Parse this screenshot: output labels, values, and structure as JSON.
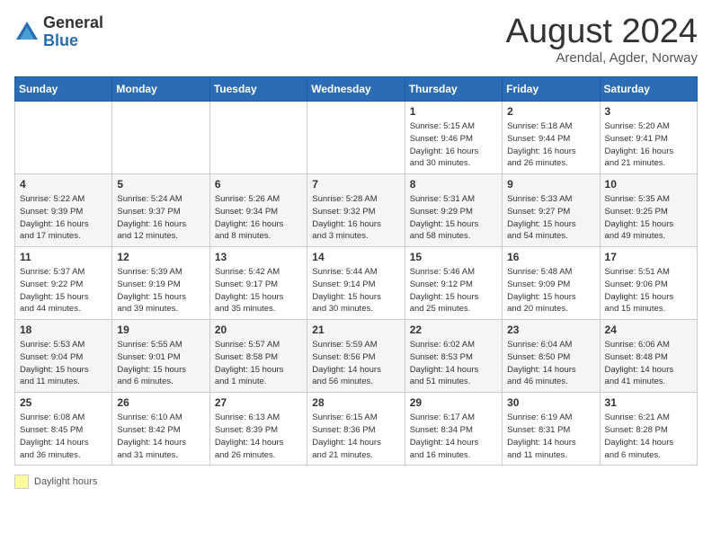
{
  "header": {
    "logo_general": "General",
    "logo_blue": "Blue",
    "month_title": "August 2024",
    "location": "Arendal, Agder, Norway"
  },
  "weekdays": [
    "Sunday",
    "Monday",
    "Tuesday",
    "Wednesday",
    "Thursday",
    "Friday",
    "Saturday"
  ],
  "weeks": [
    [
      {
        "num": "",
        "info": ""
      },
      {
        "num": "",
        "info": ""
      },
      {
        "num": "",
        "info": ""
      },
      {
        "num": "",
        "info": ""
      },
      {
        "num": "1",
        "info": "Sunrise: 5:15 AM\nSunset: 9:46 PM\nDaylight: 16 hours\nand 30 minutes."
      },
      {
        "num": "2",
        "info": "Sunrise: 5:18 AM\nSunset: 9:44 PM\nDaylight: 16 hours\nand 26 minutes."
      },
      {
        "num": "3",
        "info": "Sunrise: 5:20 AM\nSunset: 9:41 PM\nDaylight: 16 hours\nand 21 minutes."
      }
    ],
    [
      {
        "num": "4",
        "info": "Sunrise: 5:22 AM\nSunset: 9:39 PM\nDaylight: 16 hours\nand 17 minutes."
      },
      {
        "num": "5",
        "info": "Sunrise: 5:24 AM\nSunset: 9:37 PM\nDaylight: 16 hours\nand 12 minutes."
      },
      {
        "num": "6",
        "info": "Sunrise: 5:26 AM\nSunset: 9:34 PM\nDaylight: 16 hours\nand 8 minutes."
      },
      {
        "num": "7",
        "info": "Sunrise: 5:28 AM\nSunset: 9:32 PM\nDaylight: 16 hours\nand 3 minutes."
      },
      {
        "num": "8",
        "info": "Sunrise: 5:31 AM\nSunset: 9:29 PM\nDaylight: 15 hours\nand 58 minutes."
      },
      {
        "num": "9",
        "info": "Sunrise: 5:33 AM\nSunset: 9:27 PM\nDaylight: 15 hours\nand 54 minutes."
      },
      {
        "num": "10",
        "info": "Sunrise: 5:35 AM\nSunset: 9:25 PM\nDaylight: 15 hours\nand 49 minutes."
      }
    ],
    [
      {
        "num": "11",
        "info": "Sunrise: 5:37 AM\nSunset: 9:22 PM\nDaylight: 15 hours\nand 44 minutes."
      },
      {
        "num": "12",
        "info": "Sunrise: 5:39 AM\nSunset: 9:19 PM\nDaylight: 15 hours\nand 39 minutes."
      },
      {
        "num": "13",
        "info": "Sunrise: 5:42 AM\nSunset: 9:17 PM\nDaylight: 15 hours\nand 35 minutes."
      },
      {
        "num": "14",
        "info": "Sunrise: 5:44 AM\nSunset: 9:14 PM\nDaylight: 15 hours\nand 30 minutes."
      },
      {
        "num": "15",
        "info": "Sunrise: 5:46 AM\nSunset: 9:12 PM\nDaylight: 15 hours\nand 25 minutes."
      },
      {
        "num": "16",
        "info": "Sunrise: 5:48 AM\nSunset: 9:09 PM\nDaylight: 15 hours\nand 20 minutes."
      },
      {
        "num": "17",
        "info": "Sunrise: 5:51 AM\nSunset: 9:06 PM\nDaylight: 15 hours\nand 15 minutes."
      }
    ],
    [
      {
        "num": "18",
        "info": "Sunrise: 5:53 AM\nSunset: 9:04 PM\nDaylight: 15 hours\nand 11 minutes."
      },
      {
        "num": "19",
        "info": "Sunrise: 5:55 AM\nSunset: 9:01 PM\nDaylight: 15 hours\nand 6 minutes."
      },
      {
        "num": "20",
        "info": "Sunrise: 5:57 AM\nSunset: 8:58 PM\nDaylight: 15 hours\nand 1 minute."
      },
      {
        "num": "21",
        "info": "Sunrise: 5:59 AM\nSunset: 8:56 PM\nDaylight: 14 hours\nand 56 minutes."
      },
      {
        "num": "22",
        "info": "Sunrise: 6:02 AM\nSunset: 8:53 PM\nDaylight: 14 hours\nand 51 minutes."
      },
      {
        "num": "23",
        "info": "Sunrise: 6:04 AM\nSunset: 8:50 PM\nDaylight: 14 hours\nand 46 minutes."
      },
      {
        "num": "24",
        "info": "Sunrise: 6:06 AM\nSunset: 8:48 PM\nDaylight: 14 hours\nand 41 minutes."
      }
    ],
    [
      {
        "num": "25",
        "info": "Sunrise: 6:08 AM\nSunset: 8:45 PM\nDaylight: 14 hours\nand 36 minutes."
      },
      {
        "num": "26",
        "info": "Sunrise: 6:10 AM\nSunset: 8:42 PM\nDaylight: 14 hours\nand 31 minutes."
      },
      {
        "num": "27",
        "info": "Sunrise: 6:13 AM\nSunset: 8:39 PM\nDaylight: 14 hours\nand 26 minutes."
      },
      {
        "num": "28",
        "info": "Sunrise: 6:15 AM\nSunset: 8:36 PM\nDaylight: 14 hours\nand 21 minutes."
      },
      {
        "num": "29",
        "info": "Sunrise: 6:17 AM\nSunset: 8:34 PM\nDaylight: 14 hours\nand 16 minutes."
      },
      {
        "num": "30",
        "info": "Sunrise: 6:19 AM\nSunset: 8:31 PM\nDaylight: 14 hours\nand 11 minutes."
      },
      {
        "num": "31",
        "info": "Sunrise: 6:21 AM\nSunset: 8:28 PM\nDaylight: 14 hours\nand 6 minutes."
      }
    ]
  ],
  "legend": {
    "label": "Daylight hours"
  }
}
